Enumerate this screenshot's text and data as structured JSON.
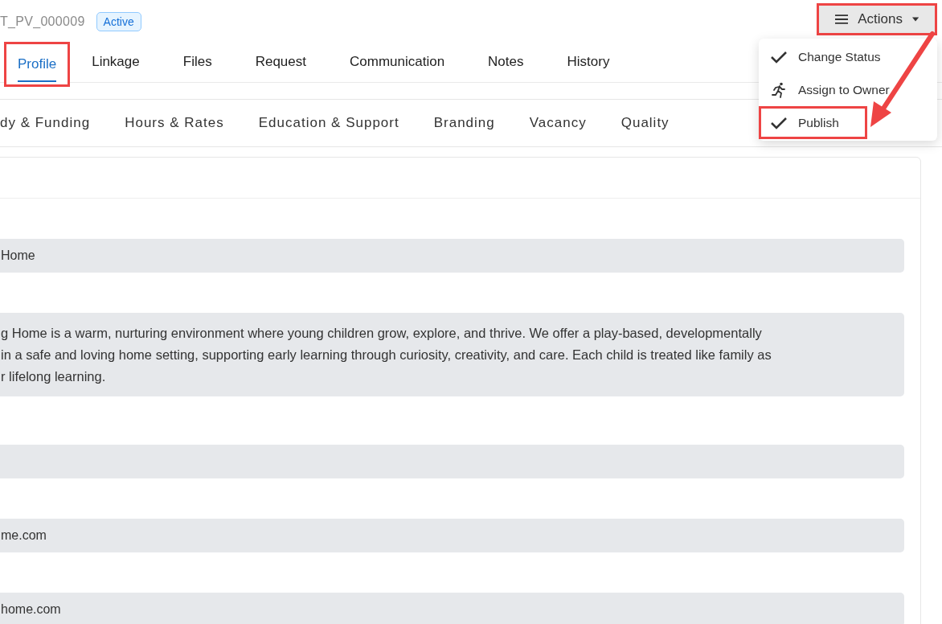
{
  "header": {
    "record_id": "T_PV_000009",
    "status_badge": "Active"
  },
  "actions_button": {
    "label": "Actions",
    "highlighted": true,
    "expanded": true
  },
  "actions_menu": [
    {
      "label": "Change Status",
      "kind": "check",
      "highlighted": false
    },
    {
      "label": "Assign to Owner",
      "kind": "run",
      "highlighted": false
    },
    {
      "label": "Publish",
      "kind": "check",
      "highlighted": true
    }
  ],
  "tabs": [
    {
      "label": "Profile",
      "selected": true,
      "highlighted": true
    },
    {
      "label": "Linkage",
      "selected": false,
      "highlighted": false
    },
    {
      "label": "Files",
      "selected": false,
      "highlighted": false
    },
    {
      "label": "Request",
      "selected": false,
      "highlighted": false
    },
    {
      "label": "Communication",
      "selected": false,
      "highlighted": false
    },
    {
      "label": "Notes",
      "selected": false,
      "highlighted": false
    },
    {
      "label": "History",
      "selected": false,
      "highlighted": false
    }
  ],
  "sub_tabs": [
    {
      "label": "dy & Funding"
    },
    {
      "label": "Hours & Rates"
    },
    {
      "label": "Education & Support"
    },
    {
      "label": "Branding"
    },
    {
      "label": "Vacancy"
    },
    {
      "label": "Quality"
    }
  ],
  "fields": [
    {
      "kind": "input",
      "value": "Home"
    },
    {
      "kind": "textarea",
      "lines": [
        "g Home is a warm, nurturing environment where young children grow, explore, and thrive. We offer a play-based, developmentally",
        "in a safe and loving home setting, supporting early learning through curiosity, creativity, and care. Each child is treated like family as",
        "r lifelong learning."
      ]
    },
    {
      "kind": "input"
    },
    {
      "kind": "input",
      "value": "me.com"
    },
    {
      "kind": "input",
      "value": "home.com"
    }
  ]
}
